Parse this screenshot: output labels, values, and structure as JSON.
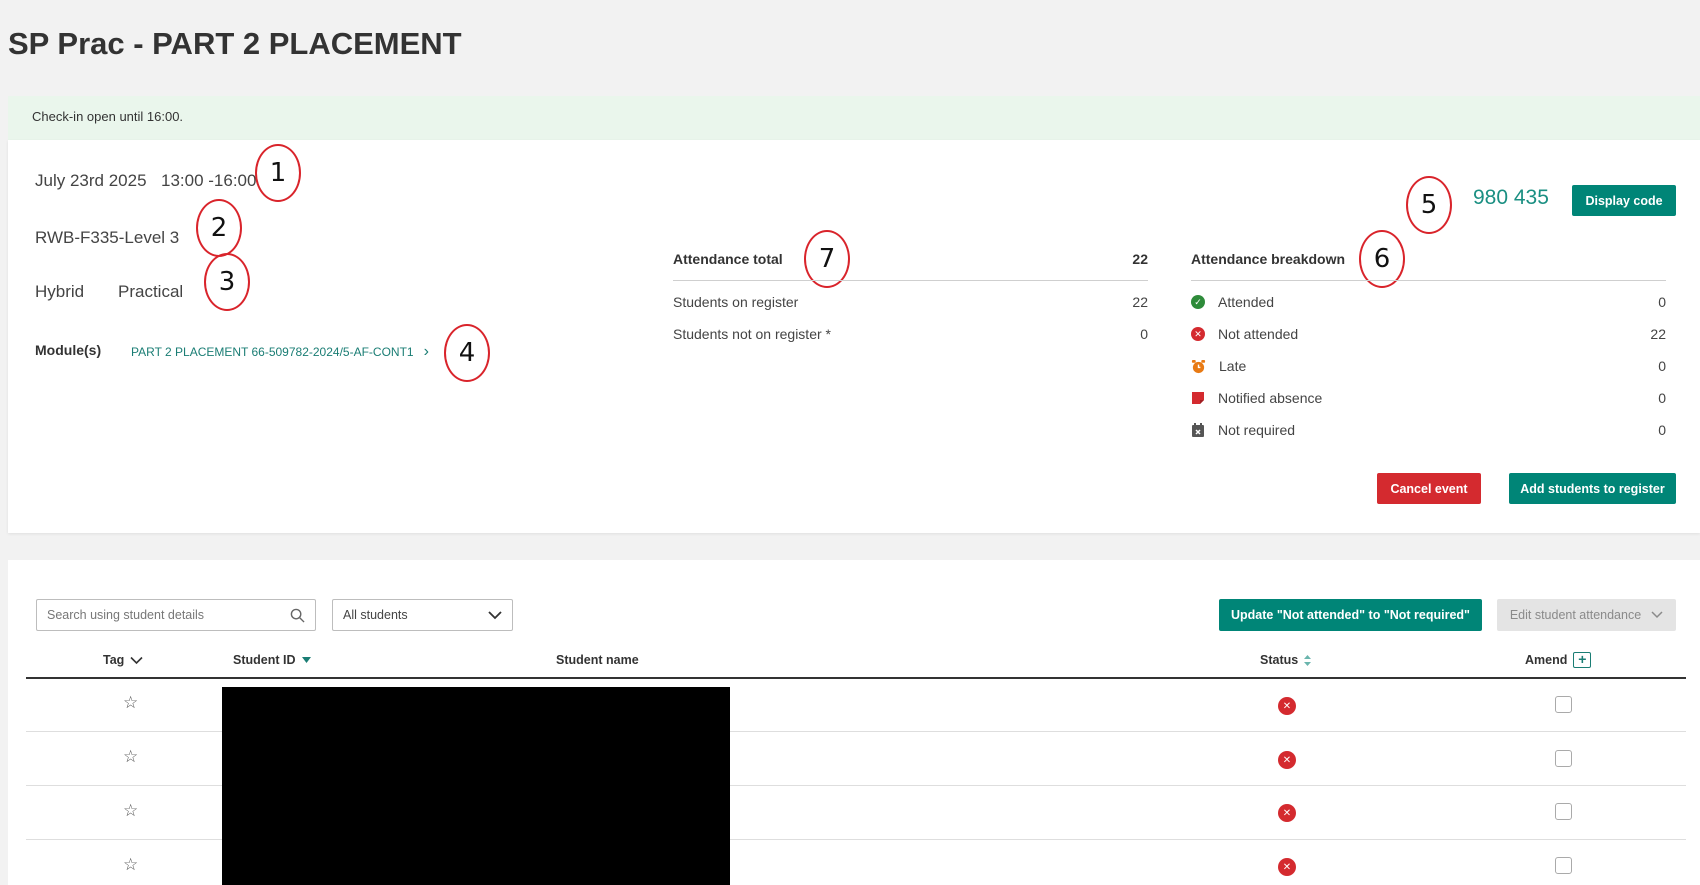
{
  "page": {
    "title": "SP Prac - PART 2 PLACEMENT"
  },
  "banner": {
    "text": "Check-in open until 16:00."
  },
  "event": {
    "date": "July 23rd 2025",
    "time": "13:00 -16:00",
    "room": "RWB-F335-Level 3",
    "mode": "Hybrid",
    "type": "Practical",
    "modules_label": "Module(s)",
    "module_link": "PART 2 PLACEMENT 66-509782-2024/5-AF-CONT1"
  },
  "checkin_code": {
    "code": "980 435",
    "display_button": "Display code"
  },
  "annotations": [
    "1",
    "2",
    "3",
    "4",
    "5",
    "6",
    "7"
  ],
  "attendance_total": {
    "title": "Attendance total",
    "total": "22",
    "rows": [
      {
        "label": "Students on register",
        "value": "22"
      },
      {
        "label": "Students not on register *",
        "value": "0"
      }
    ]
  },
  "attendance_breakdown": {
    "title": "Attendance breakdown",
    "rows": [
      {
        "label": "Attended",
        "value": "0",
        "icon": "check-circle-icon",
        "color": "#2e8b3a"
      },
      {
        "label": "Not attended",
        "value": "22",
        "icon": "x-circle-icon",
        "color": "#d42a2f"
      },
      {
        "label": "Late",
        "value": "0",
        "icon": "alarm-clock-icon",
        "color": "#e87a14"
      },
      {
        "label": "Notified absence",
        "value": "0",
        "icon": "note-icon",
        "color": "#d42a2f"
      },
      {
        "label": "Not required",
        "value": "0",
        "icon": "calendar-x-icon",
        "color": "#555555"
      }
    ]
  },
  "actions": {
    "cancel": "Cancel event",
    "add_students": "Add students to register"
  },
  "list": {
    "search_placeholder": "Search using student details",
    "filter_selected": "All students",
    "update_button": "Update \"Not attended\" to \"Not required\"",
    "edit_button": "Edit student attendance",
    "columns": {
      "tag": "Tag",
      "student_id": "Student ID",
      "student_name": "Student name",
      "status": "Status",
      "amend": "Amend"
    },
    "rows": [
      {
        "status": "not-attended"
      },
      {
        "status": "not-attended"
      },
      {
        "status": "not-attended"
      },
      {
        "status": "not-attended"
      }
    ]
  },
  "colors": {
    "accent": "#008577",
    "danger": "#d42a2f",
    "banner": "#eaf6ec"
  }
}
